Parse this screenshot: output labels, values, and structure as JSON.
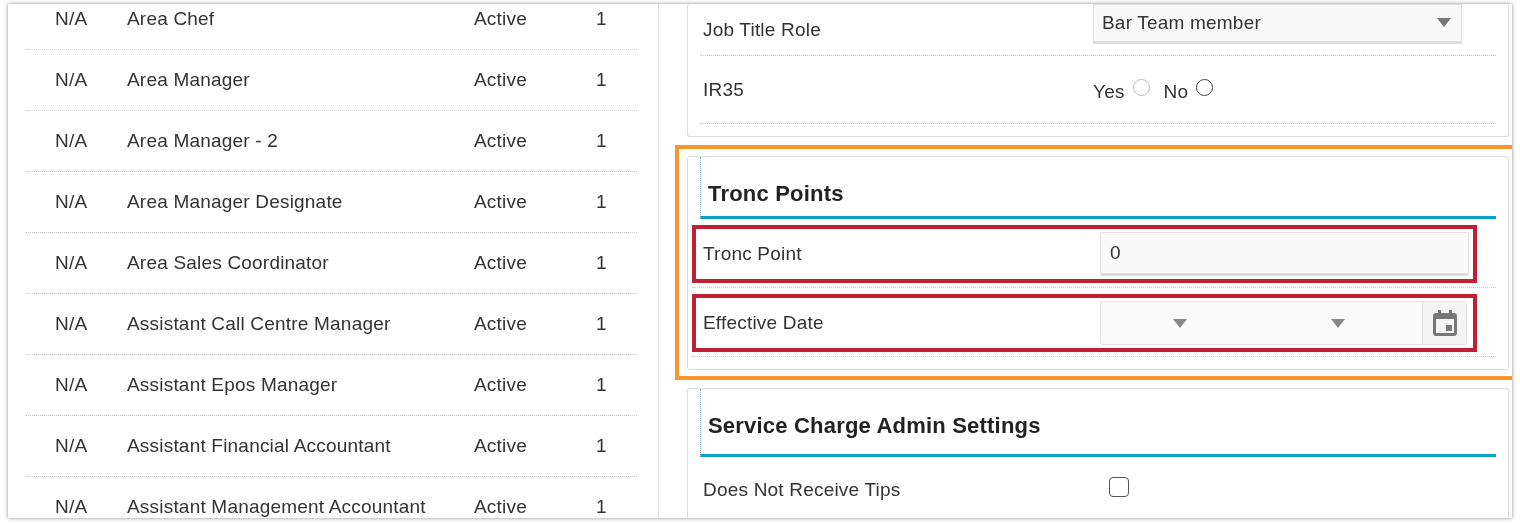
{
  "job_roles": [
    {
      "code": "N/A",
      "name": "Area Chef",
      "status": "Active",
      "count": "1"
    },
    {
      "code": "N/A",
      "name": "Area Manager",
      "status": "Active",
      "count": "1"
    },
    {
      "code": "N/A",
      "name": "Area Manager - 2",
      "status": "Active",
      "count": "1"
    },
    {
      "code": "N/A",
      "name": "Area Manager Designate",
      "status": "Active",
      "count": "1"
    },
    {
      "code": "N/A",
      "name": "Area Sales Coordinator",
      "status": "Active",
      "count": "1"
    },
    {
      "code": "N/A",
      "name": "Assistant Call Centre Manager",
      "status": "Active",
      "count": "1"
    },
    {
      "code": "N/A",
      "name": "Assistant Epos Manager",
      "status": "Active",
      "count": "1"
    },
    {
      "code": "N/A",
      "name": "Assistant Financial Accountant",
      "status": "Active",
      "count": "1"
    },
    {
      "code": "N/A",
      "name": "Assistant Management Accountant",
      "status": "Active",
      "count": "1"
    }
  ],
  "employee_settings": {
    "job_title_role": {
      "label": "Job Title Role",
      "value": "Bar Team member"
    },
    "ir35": {
      "label": "IR35",
      "options": [
        {
          "label": "Yes",
          "selected": false,
          "disabled": true
        },
        {
          "label": "No",
          "selected": false,
          "disabled": false
        }
      ]
    }
  },
  "tronc_points": {
    "title": "Tronc Points",
    "highlighted": true,
    "fields": [
      {
        "kind": "text",
        "label": "Tronc Point",
        "value": "0",
        "highlighted": true
      },
      {
        "kind": "date",
        "label": "Effective Date",
        "highlighted": true
      }
    ]
  },
  "service_charge": {
    "title": "Service Charge Admin Settings",
    "does_not_receive_tips": {
      "label": "Does Not Receive Tips",
      "checked": false
    }
  }
}
